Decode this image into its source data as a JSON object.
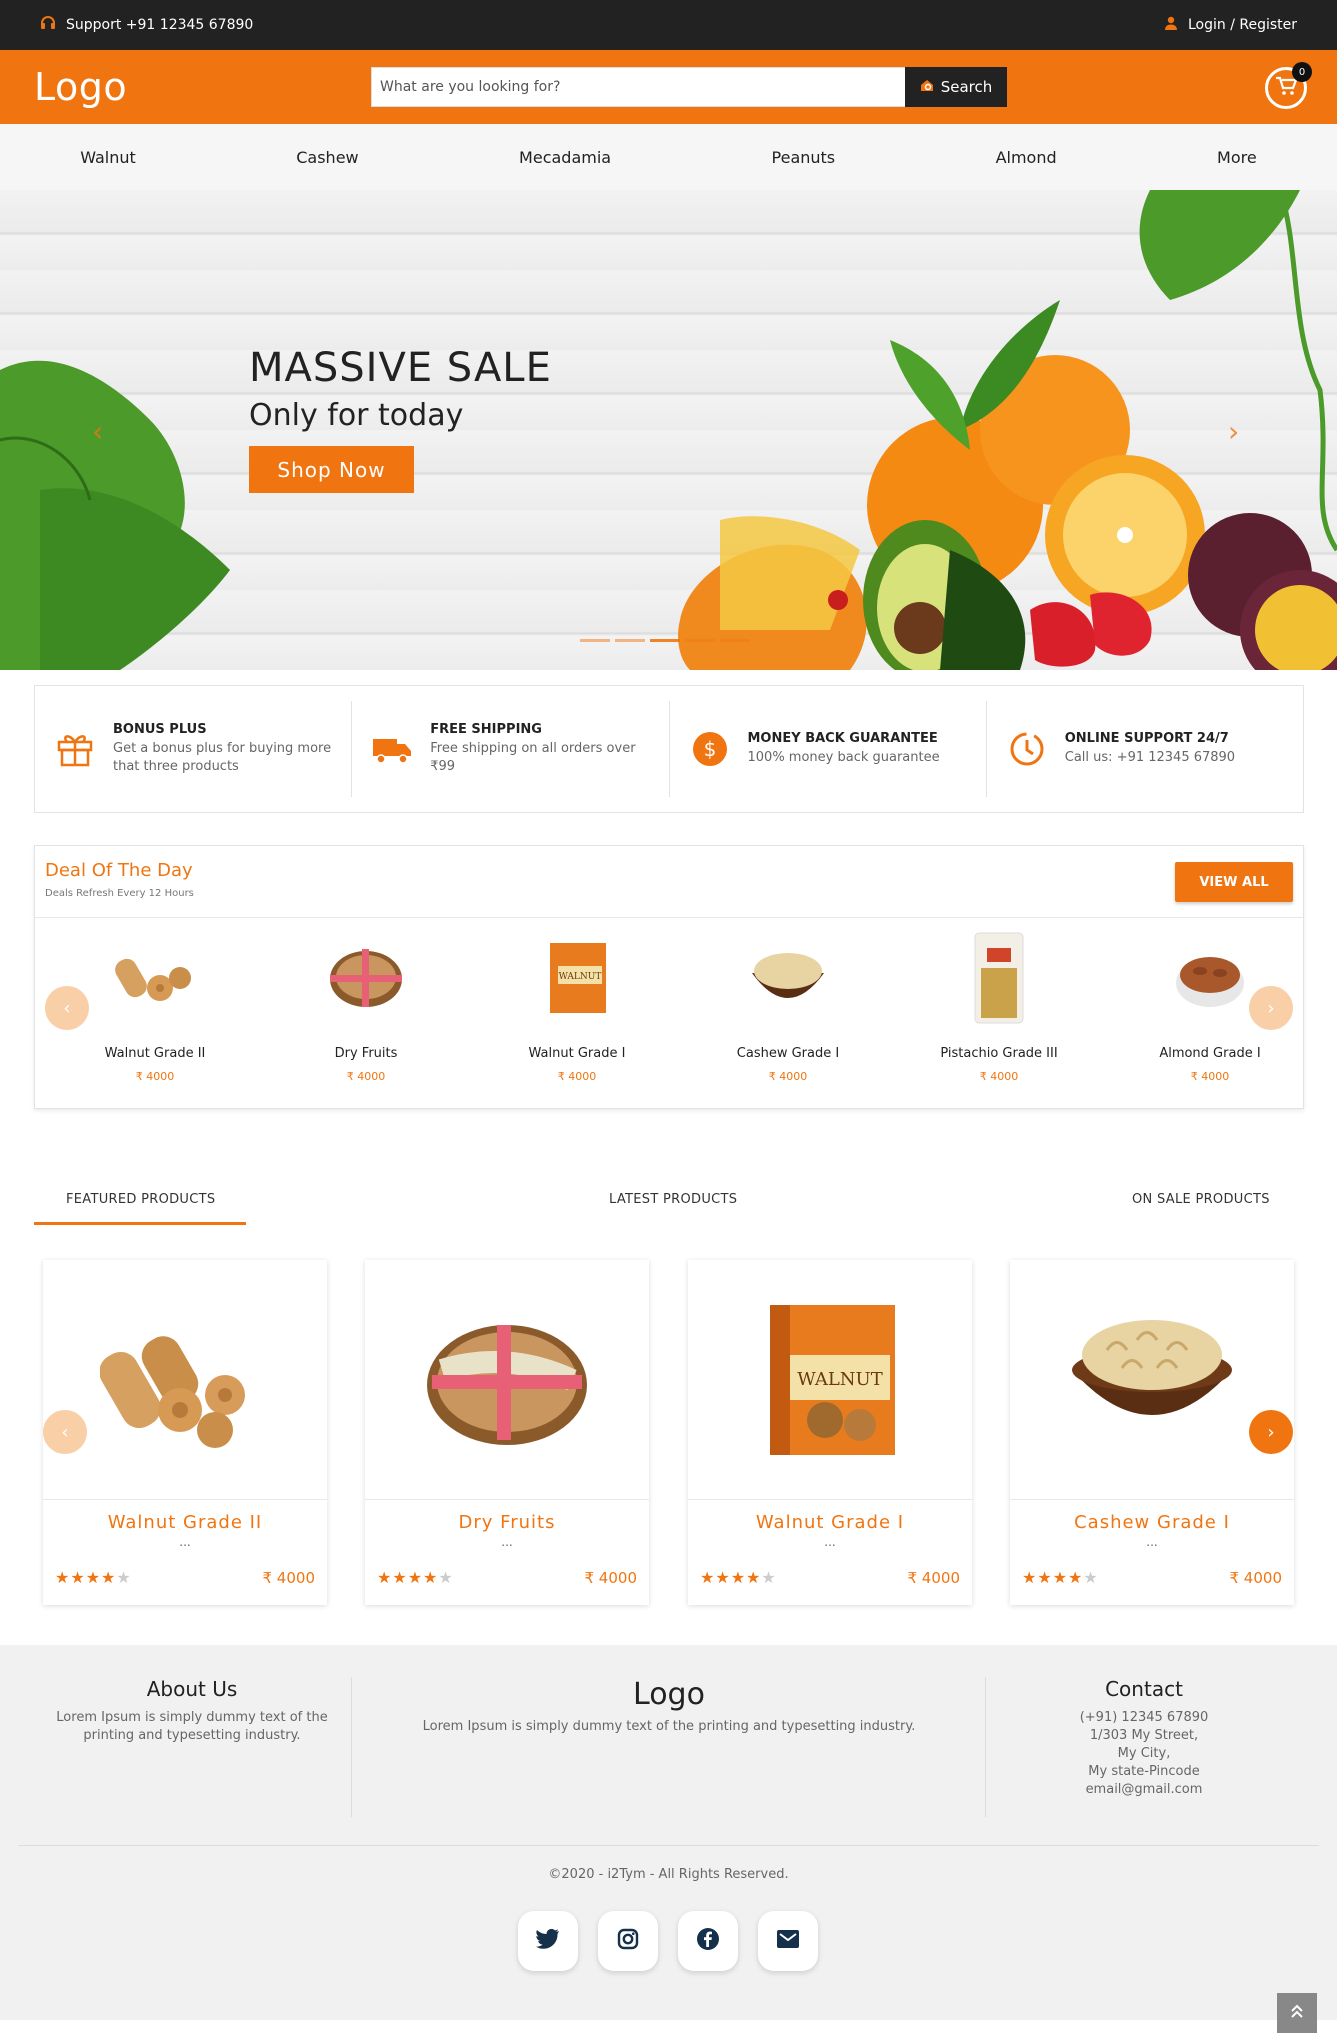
{
  "topbar": {
    "support": "Support +91 12345 67890",
    "login": "Login / Register"
  },
  "header": {
    "logo": "Logo",
    "search_placeholder": "What are you looking for?",
    "search_label": "Search",
    "cart_count": "0"
  },
  "nav": [
    "Walnut",
    "Cashew",
    "Mecadamia",
    "Peanuts",
    "Almond",
    "More"
  ],
  "hero": {
    "title": "MASSIVE SALE",
    "subtitle": "Only for today",
    "cta": "Shop Now"
  },
  "features": [
    {
      "title": "BONUS PLUS",
      "text": "Get a bonus plus for buying more that three products",
      "icon": "gift-icon"
    },
    {
      "title": "FREE SHIPPING",
      "text": "Free shipping on all orders over ₹99",
      "icon": "truck-icon"
    },
    {
      "title": "MONEY BACK GUARANTEE",
      "text": "100% money back guarantee",
      "icon": "money-icon"
    },
    {
      "title": "ONLINE SUPPORT 24/7",
      "text": "Call us: +91 12345 67890",
      "icon": "clock-icon"
    }
  ],
  "deal": {
    "title": "Deal Of The Day",
    "subtitle": "Deals Refresh Every 12 Hours",
    "view_all": "VIEW ALL",
    "items": [
      {
        "name": "Walnut Grade II",
        "price": "₹ 4000"
      },
      {
        "name": "Dry Fruits",
        "price": "₹ 4000"
      },
      {
        "name": "Walnut Grade I",
        "price": "₹ 4000"
      },
      {
        "name": "Cashew Grade I",
        "price": "₹ 4000"
      },
      {
        "name": "Pistachio Grade III",
        "price": "₹ 4000"
      },
      {
        "name": "Almond Grade I",
        "price": "₹ 4000"
      }
    ]
  },
  "tabs": [
    "FEATURED PRODUCTS",
    "LATEST PRODUCTS",
    "ON SALE PRODUCTS"
  ],
  "products": [
    {
      "name": "Walnut Grade II",
      "desc": "...",
      "price": "₹ 4000",
      "rating": 3.5
    },
    {
      "name": "Dry Fruits",
      "desc": "...",
      "price": "₹ 4000",
      "rating": 3.5
    },
    {
      "name": "Walnut Grade I",
      "desc": "...",
      "price": "₹ 4000",
      "rating": 3.5
    },
    {
      "name": "Cashew Grade I",
      "desc": "...",
      "price": "₹ 4000",
      "rating": 3.5
    }
  ],
  "footer": {
    "about_title": "About Us",
    "about_text": "Lorem Ipsum is simply dummy text of the printing and typesetting industry.",
    "logo": "Logo",
    "logo_text": "Lorem Ipsum is simply dummy text of the printing and typesetting industry.",
    "contact_title": "Contact",
    "contact_lines": [
      "(+91) 12345 67890",
      "1/303 My Street,",
      "My City,",
      "My state-Pincode",
      "email@gmail.com"
    ],
    "copyright": "©2020 - i2Tym - All Rights Reserved."
  },
  "colors": {
    "accent": "#f07511",
    "dark": "#222222",
    "footer_bg": "#f1f1f1"
  }
}
